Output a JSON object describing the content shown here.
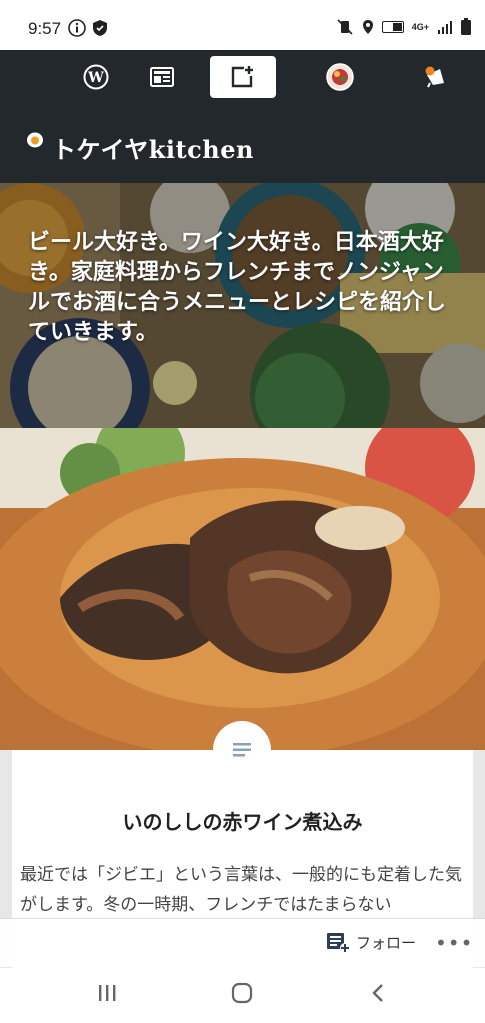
{
  "status_bar": {
    "time": "9:57",
    "left_icons": [
      "info-icon",
      "shield-icon"
    ],
    "right_icons": [
      "mute-vibrate-icon",
      "location-icon",
      "volte-icon",
      "4g-data-icon",
      "signal-icon",
      "battery-icon"
    ],
    "network_label": "4G+"
  },
  "wp_toolbar": {
    "items": [
      {
        "name": "wordpress-icon"
      },
      {
        "name": "reader-icon"
      },
      {
        "name": "write-post-icon",
        "active": true
      },
      {
        "name": "avatar-icon"
      },
      {
        "name": "notifications-icon",
        "badge": true
      }
    ]
  },
  "site": {
    "title": "トケイヤkitchen",
    "tagline": "ビール大好き。ワイン大好き。日本酒大好き。家庭料理からフレンチまでノンジャンルでお酒に合うメニューとレシピを紹介していきます。"
  },
  "post": {
    "title": "いのししの赤ワイン煮込み",
    "excerpt": "最近では「ジビエ」という言葉は、一般的にも定着した気がします。冬の一時期、フレンチではたまらない"
  },
  "follow_bar": {
    "follow_label": "フォロー",
    "more_label": "•••"
  },
  "colors": {
    "wp_bar": "#23282d",
    "notification_badge": "#f0821e"
  }
}
